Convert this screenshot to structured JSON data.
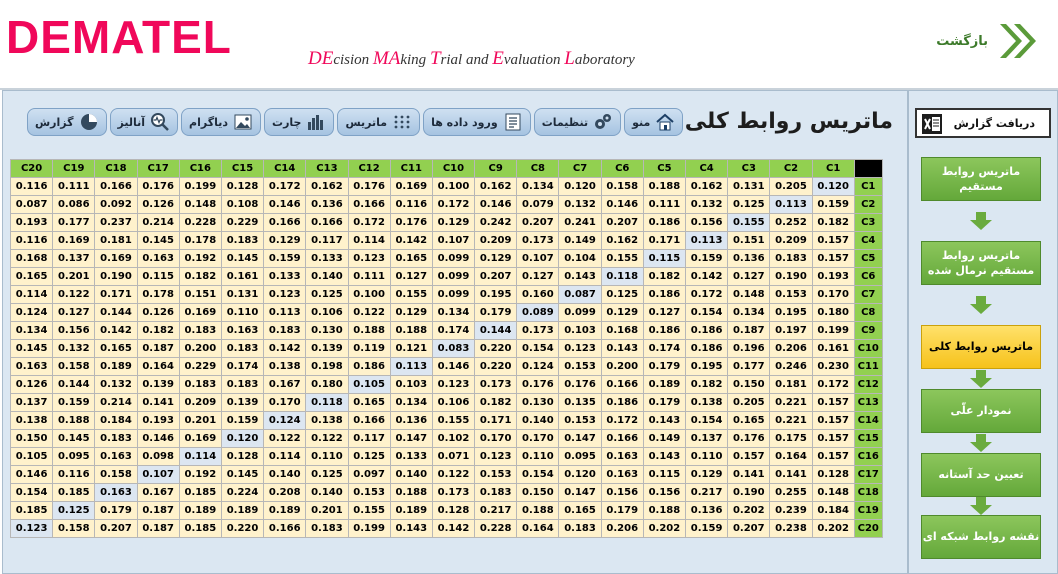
{
  "header": {
    "logo": "DEMATEL",
    "subtitle_parts": [
      {
        "cap": "DE",
        "rest": "cision "
      },
      {
        "cap": "MA",
        "rest": "king "
      },
      {
        "cap": "T",
        "rest": "rial and "
      },
      {
        "cap": "E",
        "rest": "valuation "
      },
      {
        "cap": "L",
        "rest": "aboratory"
      }
    ],
    "back_label": "بازگشت"
  },
  "page": {
    "title": "ماتریس روابط کلی"
  },
  "toolbar": [
    {
      "label": "منو",
      "icon": "home-icon"
    },
    {
      "label": "تنظیمات",
      "icon": "gears-icon"
    },
    {
      "label": "ورود داده ها",
      "icon": "data-entry-icon"
    },
    {
      "label": "ماتریس",
      "icon": "matrix-icon"
    },
    {
      "label": "چارت",
      "icon": "bar-chart-icon"
    },
    {
      "label": "دیاگرام",
      "icon": "picture-icon"
    },
    {
      "label": "آنالیز",
      "icon": "magnifier-icon"
    },
    {
      "label": "گزارش",
      "icon": "pie-chart-icon"
    }
  ],
  "sidebar": {
    "export_label": "دریافت گزارش",
    "steps": [
      {
        "label": "ماتریس روابط مستقیم",
        "active": false
      },
      {
        "label": "ماتریس روابط مستقیم نرمال شده",
        "active": false
      },
      {
        "label": "ماتریس روابط کلی",
        "active": true
      },
      {
        "label": "نمودار علّی",
        "active": false
      },
      {
        "label": "تعیین حد آستانه",
        "active": false
      },
      {
        "label": "نقشه روابط شبکه ای",
        "active": false
      }
    ]
  },
  "matrix": {
    "col_headers": [
      "C1",
      "C2",
      "C3",
      "C4",
      "C5",
      "C6",
      "C7",
      "C8",
      "C9",
      "C10",
      "C11",
      "C12",
      "C13",
      "C14",
      "C15",
      "C16",
      "C17",
      "C18",
      "C19",
      "C20"
    ],
    "row_headers": [
      "C1",
      "C2",
      "C3",
      "C4",
      "C5",
      "C6",
      "C7",
      "C8",
      "C9",
      "C10",
      "C11",
      "C12",
      "C13",
      "C14",
      "C15",
      "C16",
      "C17",
      "C18",
      "C19",
      "C20"
    ],
    "rows": [
      [
        "0.120",
        "0.205",
        "0.131",
        "0.162",
        "0.188",
        "0.158",
        "0.120",
        "0.134",
        "0.162",
        "0.100",
        "0.169",
        "0.176",
        "0.162",
        "0.172",
        "0.128",
        "0.199",
        "0.176",
        "0.166",
        "0.111",
        "0.116"
      ],
      [
        "0.159",
        "0.113",
        "0.125",
        "0.132",
        "0.111",
        "0.146",
        "0.132",
        "0.079",
        "0.146",
        "0.172",
        "0.116",
        "0.166",
        "0.136",
        "0.146",
        "0.108",
        "0.148",
        "0.126",
        "0.092",
        "0.086",
        "0.087"
      ],
      [
        "0.182",
        "0.252",
        "0.155",
        "0.156",
        "0.186",
        "0.207",
        "0.241",
        "0.207",
        "0.242",
        "0.129",
        "0.176",
        "0.172",
        "0.166",
        "0.166",
        "0.229",
        "0.228",
        "0.214",
        "0.237",
        "0.177",
        "0.193"
      ],
      [
        "0.157",
        "0.209",
        "0.151",
        "0.113",
        "0.171",
        "0.162",
        "0.149",
        "0.173",
        "0.209",
        "0.107",
        "0.142",
        "0.114",
        "0.117",
        "0.129",
        "0.183",
        "0.178",
        "0.145",
        "0.181",
        "0.169",
        "0.116"
      ],
      [
        "0.157",
        "0.183",
        "0.136",
        "0.159",
        "0.115",
        "0.155",
        "0.104",
        "0.107",
        "0.129",
        "0.099",
        "0.165",
        "0.123",
        "0.133",
        "0.159",
        "0.145",
        "0.192",
        "0.163",
        "0.169",
        "0.137",
        "0.168"
      ],
      [
        "0.193",
        "0.190",
        "0.127",
        "0.142",
        "0.182",
        "0.118",
        "0.143",
        "0.127",
        "0.207",
        "0.099",
        "0.127",
        "0.111",
        "0.140",
        "0.133",
        "0.161",
        "0.182",
        "0.115",
        "0.190",
        "0.201",
        "0.165"
      ],
      [
        "0.170",
        "0.153",
        "0.148",
        "0.172",
        "0.186",
        "0.125",
        "0.087",
        "0.160",
        "0.195",
        "0.099",
        "0.155",
        "0.100",
        "0.125",
        "0.123",
        "0.131",
        "0.151",
        "0.178",
        "0.171",
        "0.122",
        "0.114"
      ],
      [
        "0.180",
        "0.195",
        "0.134",
        "0.154",
        "0.127",
        "0.129",
        "0.099",
        "0.089",
        "0.179",
        "0.134",
        "0.129",
        "0.122",
        "0.106",
        "0.113",
        "0.110",
        "0.169",
        "0.126",
        "0.144",
        "0.127",
        "0.124"
      ],
      [
        "0.199",
        "0.197",
        "0.187",
        "0.186",
        "0.186",
        "0.168",
        "0.103",
        "0.173",
        "0.144",
        "0.174",
        "0.188",
        "0.188",
        "0.130",
        "0.183",
        "0.163",
        "0.183",
        "0.182",
        "0.142",
        "0.156",
        "0.134"
      ],
      [
        "0.161",
        "0.206",
        "0.196",
        "0.186",
        "0.174",
        "0.143",
        "0.123",
        "0.154",
        "0.220",
        "0.083",
        "0.121",
        "0.119",
        "0.139",
        "0.142",
        "0.183",
        "0.200",
        "0.187",
        "0.165",
        "0.132",
        "0.145"
      ],
      [
        "0.230",
        "0.246",
        "0.177",
        "0.195",
        "0.179",
        "0.200",
        "0.153",
        "0.124",
        "0.220",
        "0.146",
        "0.113",
        "0.186",
        "0.198",
        "0.138",
        "0.174",
        "0.229",
        "0.164",
        "0.189",
        "0.158",
        "0.163"
      ],
      [
        "0.172",
        "0.181",
        "0.150",
        "0.182",
        "0.189",
        "0.166",
        "0.176",
        "0.176",
        "0.173",
        "0.123",
        "0.103",
        "0.105",
        "0.180",
        "0.167",
        "0.183",
        "0.183",
        "0.139",
        "0.132",
        "0.144",
        "0.126"
      ],
      [
        "0.157",
        "0.221",
        "0.205",
        "0.138",
        "0.179",
        "0.186",
        "0.135",
        "0.130",
        "0.182",
        "0.106",
        "0.134",
        "0.165",
        "0.118",
        "0.170",
        "0.139",
        "0.209",
        "0.141",
        "0.214",
        "0.159",
        "0.137"
      ],
      [
        "0.157",
        "0.221",
        "0.165",
        "0.154",
        "0.143",
        "0.172",
        "0.153",
        "0.140",
        "0.171",
        "0.155",
        "0.136",
        "0.166",
        "0.138",
        "0.124",
        "0.159",
        "0.201",
        "0.193",
        "0.184",
        "0.188",
        "0.138"
      ],
      [
        "0.157",
        "0.175",
        "0.176",
        "0.137",
        "0.149",
        "0.166",
        "0.147",
        "0.170",
        "0.170",
        "0.102",
        "0.147",
        "0.117",
        "0.122",
        "0.122",
        "0.120",
        "0.169",
        "0.146",
        "0.183",
        "0.145",
        "0.150"
      ],
      [
        "0.157",
        "0.164",
        "0.157",
        "0.110",
        "0.143",
        "0.163",
        "0.095",
        "0.110",
        "0.123",
        "0.071",
        "0.133",
        "0.125",
        "0.110",
        "0.114",
        "0.128",
        "0.114",
        "0.098",
        "0.163",
        "0.095",
        "0.105"
      ],
      [
        "0.128",
        "0.141",
        "0.141",
        "0.129",
        "0.115",
        "0.163",
        "0.120",
        "0.154",
        "0.153",
        "0.122",
        "0.140",
        "0.097",
        "0.125",
        "0.140",
        "0.145",
        "0.192",
        "0.107",
        "0.158",
        "0.116",
        "0.146"
      ],
      [
        "0.148",
        "0.255",
        "0.190",
        "0.217",
        "0.156",
        "0.156",
        "0.147",
        "0.150",
        "0.183",
        "0.173",
        "0.188",
        "0.153",
        "0.140",
        "0.208",
        "0.224",
        "0.185",
        "0.167",
        "0.163",
        "0.185",
        "0.154"
      ],
      [
        "0.184",
        "0.239",
        "0.202",
        "0.136",
        "0.188",
        "0.179",
        "0.165",
        "0.188",
        "0.217",
        "0.128",
        "0.189",
        "0.155",
        "0.201",
        "0.189",
        "0.189",
        "0.189",
        "0.187",
        "0.179",
        "0.125",
        "0.185"
      ],
      [
        "0.202",
        "0.238",
        "0.207",
        "0.159",
        "0.202",
        "0.206",
        "0.183",
        "0.164",
        "0.228",
        "0.142",
        "0.143",
        "0.199",
        "0.183",
        "0.166",
        "0.220",
        "0.185",
        "0.187",
        "0.207",
        "0.158",
        "0.123"
      ]
    ]
  },
  "colors": {
    "brand": "#f0085a",
    "header_green": "#92d050",
    "cell_fill": "#fff2cc",
    "diag_fill": "#dce6f1",
    "step_green": "#6aab3e",
    "step_active": "#f6c21b",
    "panel_bg": "#dbe7f2"
  }
}
